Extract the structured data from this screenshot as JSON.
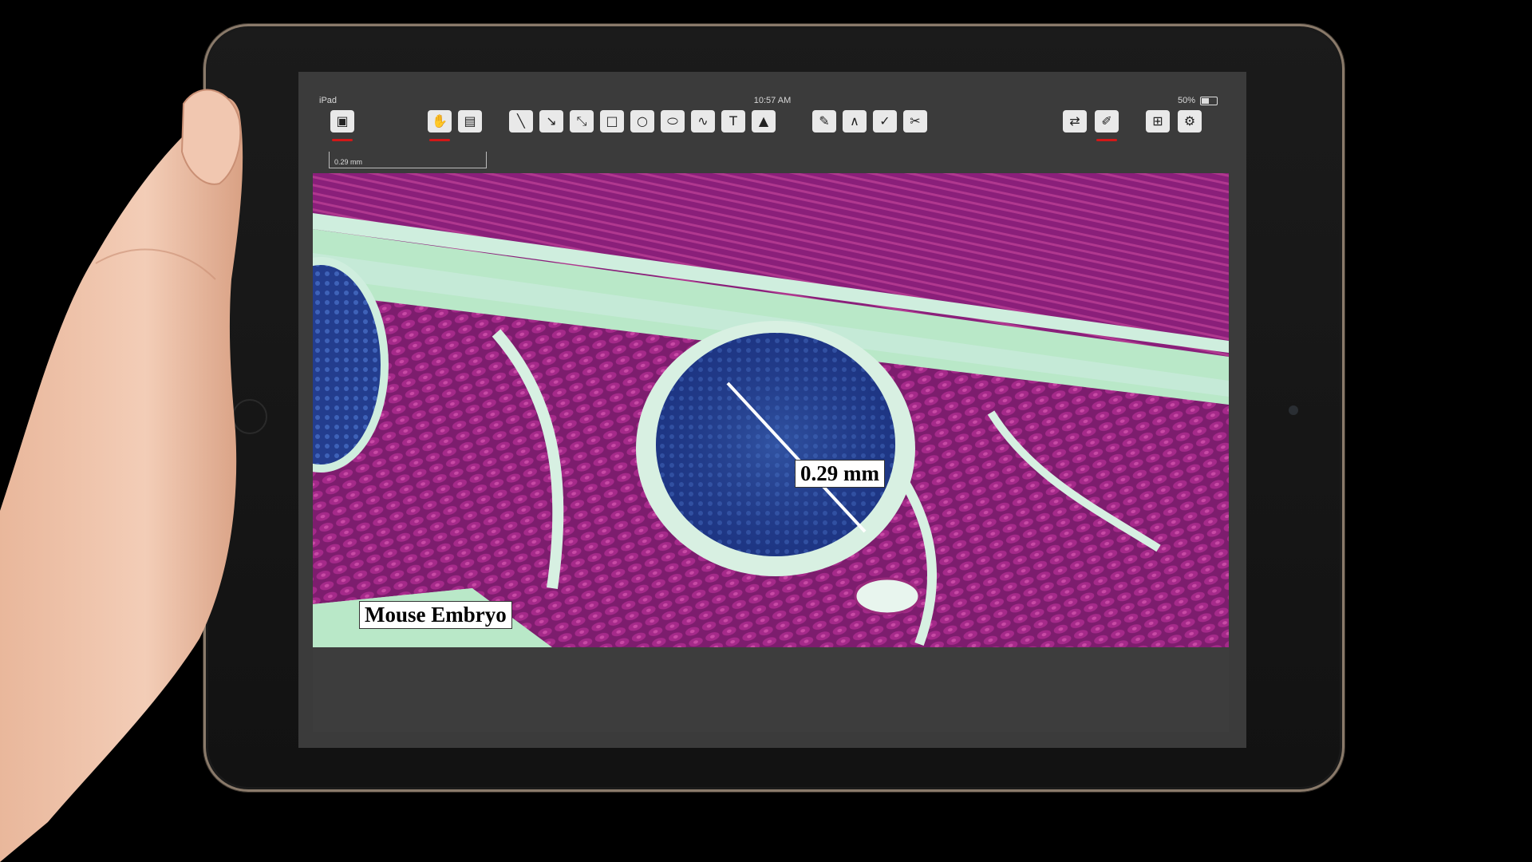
{
  "status_bar": {
    "device": "iPad",
    "time": "10:57 AM",
    "battery": "50%",
    "battery_level": 0.5
  },
  "toolbar": {
    "left_tools": [
      {
        "icon": "image-icon",
        "active": true
      }
    ],
    "view_tools": [
      {
        "icon": "hand-pan-icon",
        "active": true
      },
      {
        "icon": "clipboard-icon",
        "active": false
      }
    ],
    "measure_tools": [
      {
        "icon": "line-icon"
      },
      {
        "icon": "arrow-line-icon"
      },
      {
        "icon": "dimension-line-icon"
      },
      {
        "icon": "rectangle-icon"
      },
      {
        "icon": "circle-icon"
      },
      {
        "icon": "ellipse-icon"
      },
      {
        "icon": "freehand-icon"
      },
      {
        "icon": "text-box-icon"
      },
      {
        "icon": "image-stamp-icon"
      }
    ],
    "edit_tools": [
      {
        "icon": "pen-icon"
      },
      {
        "icon": "angle-icon"
      },
      {
        "icon": "check-icon"
      },
      {
        "icon": "cut-icon"
      }
    ],
    "right_tools": [
      {
        "icon": "adjust-icon",
        "active": false
      },
      {
        "icon": "edit-note-icon",
        "active": true
      },
      {
        "icon": "grid-icon",
        "active": false
      },
      {
        "icon": "settings-icon",
        "active": false
      }
    ]
  },
  "scale_bar": {
    "label": "0.29 mm"
  },
  "annotations": {
    "measurement_label": "0.29 mm",
    "caption": "Mouse Embryo"
  },
  "colors": {
    "accent": "#d21818",
    "stain_purple": "#8a1f7a",
    "stain_blue": "#2a3f9a",
    "stain_green": "#b8e6c6"
  }
}
